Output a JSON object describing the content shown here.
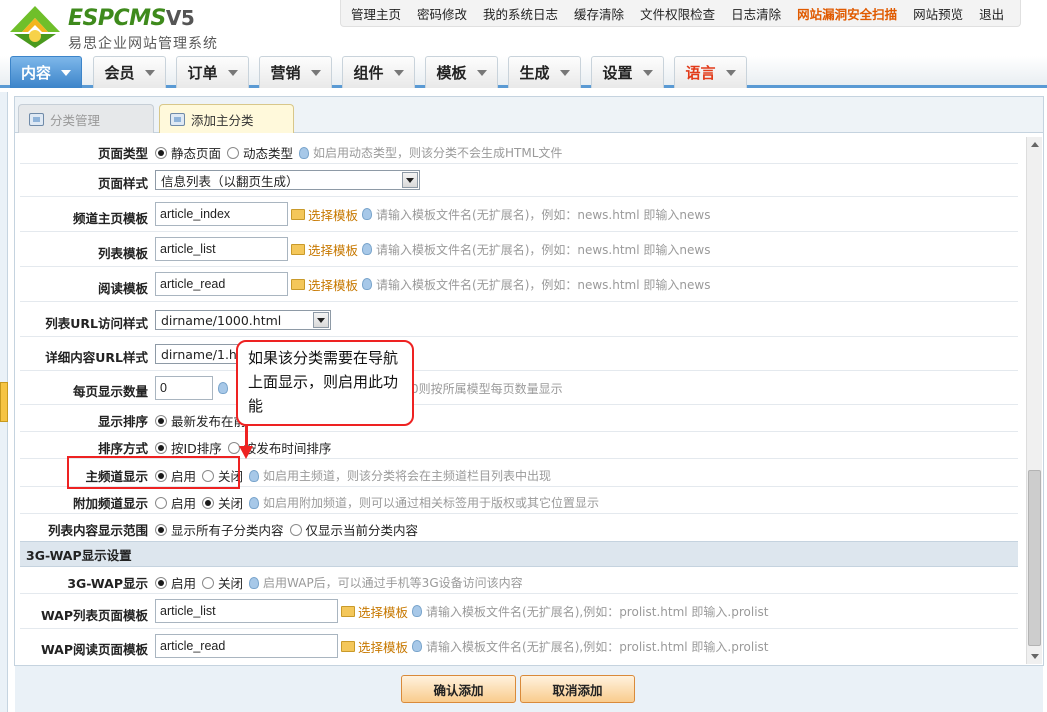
{
  "logo": {
    "brand": "ESPCMS",
    "version": "V5",
    "subtitle": "易思企业网站管理系统"
  },
  "topnav": [
    "管理主页",
    "密码修改",
    "我的系统日志",
    "缓存清除",
    "文件权限检查",
    "日志清除",
    "网站漏洞安全扫描",
    "网站预览",
    "退出"
  ],
  "mainmenu": [
    "内容",
    "会员",
    "订单",
    "营销",
    "组件",
    "模板",
    "生成",
    "设置",
    "语言"
  ],
  "subtabs": [
    "分类管理",
    "添加主分类"
  ],
  "form": {
    "page_type": {
      "label": "页面类型",
      "opt1": "静态页面",
      "opt2": "动态类型",
      "hint": "如启用动态类型，则该分类不会生成HTML文件"
    },
    "page_style": {
      "label": "页面样式",
      "value": "信息列表（以翻页生成）"
    },
    "channel_tpl": {
      "label": "频道主页模板",
      "value": "article_index",
      "choose": "选择模板",
      "hint": "请输入模板文件名(无扩展名)，例如：news.html 即输入news"
    },
    "list_tpl": {
      "label": "列表模板",
      "value": "article_list",
      "choose": "选择模板",
      "hint": "请输入模板文件名(无扩展名)，例如：news.html 即输入news"
    },
    "read_tpl": {
      "label": "阅读模板",
      "value": "article_read",
      "choose": "选择模板",
      "hint": "请输入模板文件名(无扩展名)，例如：news.html 即输入news"
    },
    "list_url": {
      "label": "列表URL访问样式",
      "value": "dirname/1000.html"
    },
    "detail_url": {
      "label": "详细内容URL样式",
      "value": "dirname/1.htm"
    },
    "per_page": {
      "label": "每页显示数量",
      "value": "0",
      "hint": "或为0则按所属模型每页数量显示"
    },
    "sort_show": {
      "label": "显示排序",
      "opt1": "最新发布在前"
    },
    "sort_mode": {
      "label": "排序方式",
      "opt1": "按ID排序",
      "opt2": "按发布时间排序"
    },
    "main_channel": {
      "label": "主频道显示",
      "opt1": "启用",
      "opt2": "关闭",
      "hint": "如启用主频道，则该分类将会在主频道栏目列表中出现"
    },
    "extra_channel": {
      "label": "附加频道显示",
      "opt1": "启用",
      "opt2": "关闭",
      "hint": "如启用附加频道，则可以通过相关标签用于版权或其它位置显示"
    },
    "list_scope": {
      "label": "列表内容显示范围",
      "opt1": "显示所有子分类内容",
      "opt2": "仅显示当前分类内容"
    },
    "wap_section": "3G-WAP显示设置",
    "wap_show": {
      "label": "3G-WAP显示",
      "opt1": "启用",
      "opt2": "关闭",
      "hint": "启用WAP后，可以通过手机等3G设备访问该内容"
    },
    "wap_list_tpl": {
      "label": "WAP列表页面模板",
      "value": "article_list",
      "choose": "选择模板",
      "hint": "请输入模板文件名(无扩展名),例如：prolist.html 即输入.prolist"
    },
    "wap_read_tpl": {
      "label": "WAP阅读页面模板",
      "value": "article_read",
      "choose": "选择模板",
      "hint": "请输入模板文件名(无扩展名),例如：prolist.html 即输入.prolist"
    }
  },
  "buttons": {
    "confirm": "确认添加",
    "cancel": "取消添加"
  },
  "annotation": {
    "text": "如果该分类需要在导航上面显示，则启用此功能"
  }
}
